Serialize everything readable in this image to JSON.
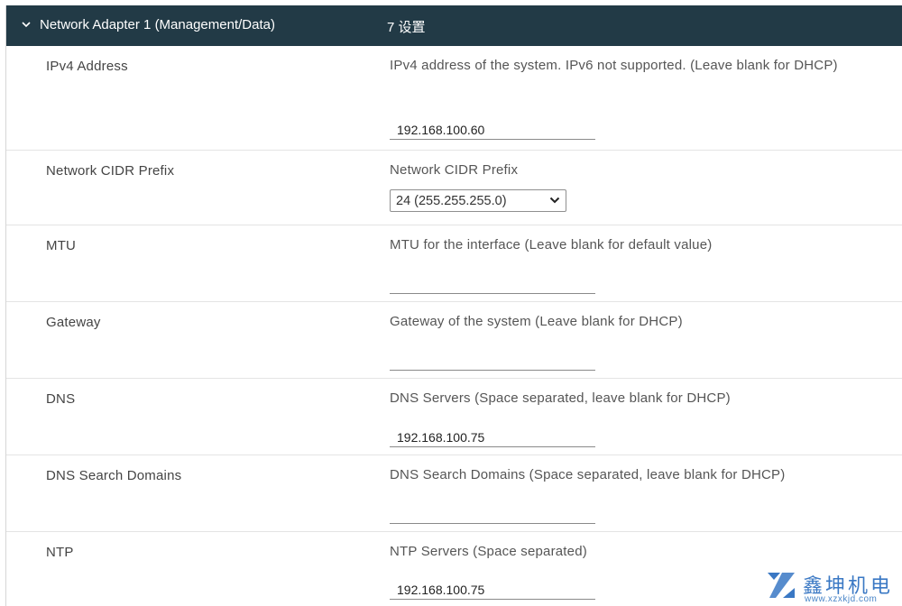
{
  "header": {
    "title": "Network Adapter 1 (Management/Data)",
    "count": "7 设置",
    "icon": "chevron-down-icon"
  },
  "rows": {
    "ipv4": {
      "label": "IPv4 Address",
      "description": "IPv4 address of the system. IPv6 not supported. (Leave blank for DHCP)",
      "value": "192.168.100.60"
    },
    "cidr": {
      "label": "Network CIDR Prefix",
      "description": "Network CIDR Prefix",
      "selected": "24 (255.255.255.0)"
    },
    "mtu": {
      "label": "MTU",
      "description": "MTU for the interface (Leave blank for default value)",
      "value": ""
    },
    "gateway": {
      "label": "Gateway",
      "description": "Gateway of the system (Leave blank for DHCP)",
      "value": ""
    },
    "dns": {
      "label": "DNS",
      "description": "DNS Servers (Space separated, leave blank for DHCP)",
      "value": "192.168.100.75"
    },
    "dns_search": {
      "label": "DNS Search Domains",
      "description": "DNS Search Domains (Space separated, leave blank for DHCP)",
      "value": ""
    },
    "ntp": {
      "label": "NTP",
      "description": "NTP Servers (Space separated)",
      "value": "192.168.100.75"
    }
  },
  "watermark": {
    "name": "鑫坤机电",
    "url": "www.xzxkjd.com"
  },
  "colors": {
    "header_bg": "#223a46",
    "watermark": "#3a78c4"
  }
}
